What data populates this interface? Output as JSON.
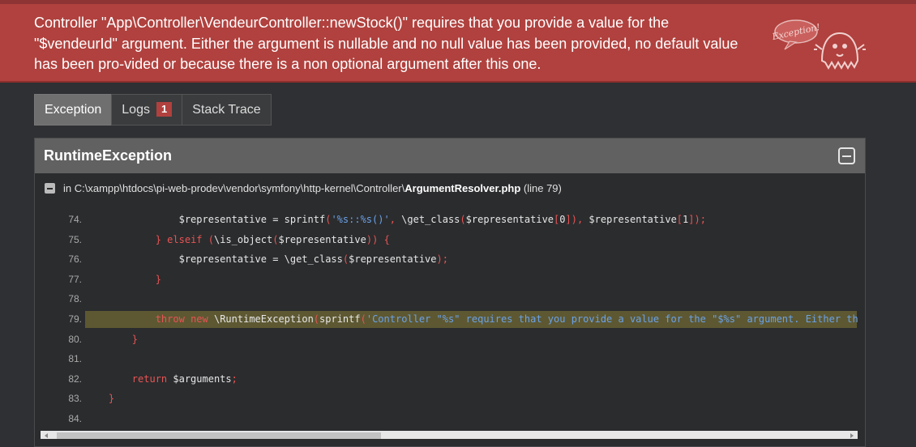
{
  "header": {
    "message": "Controller \"App\\Controller\\VendeurController::newStock()\" requires that you provide a value for the \"$vendeurId\" argument. Either the argument is nullable and no null value has been provided, no default value has been pro-vided or because there is a non optional argument after this one.",
    "ghost_label": "Exception!"
  },
  "tabs": [
    {
      "label": "Exception",
      "active": true
    },
    {
      "label": "Logs",
      "badge": "1"
    },
    {
      "label": "Stack Trace"
    }
  ],
  "exception": {
    "class_name": "RuntimeException",
    "file_prefix": "in C:\\xampp\\htdocs\\pi-web-prodev\\vendor\\symfony\\http-kernel\\Controller\\",
    "file_name": "ArgumentResolver.php",
    "file_suffix": " (line 79)"
  },
  "code_lines": [
    {
      "num": "74.",
      "indent": "                ",
      "code": "$representative = sprintf('%s::%s()', \\get_class($representative[0]), $representative[1]);"
    },
    {
      "num": "75.",
      "indent": "            ",
      "code": "} elseif (\\is_object($representative)) {"
    },
    {
      "num": "76.",
      "indent": "                ",
      "code": "$representative = \\get_class($representative);"
    },
    {
      "num": "77.",
      "indent": "            ",
      "code": "}"
    },
    {
      "num": "78.",
      "indent": "",
      "code": ""
    },
    {
      "num": "79.",
      "indent": "            ",
      "code": "throw new \\RuntimeException(sprintf('Controller \"%s\" requires that you provide a value for the \"$%s\" argument. Either th",
      "highlight": true
    },
    {
      "num": "80.",
      "indent": "        ",
      "code": "}"
    },
    {
      "num": "81.",
      "indent": "",
      "code": ""
    },
    {
      "num": "82.",
      "indent": "        ",
      "code": "return $arguments;"
    },
    {
      "num": "83.",
      "indent": "    ",
      "code": "}"
    },
    {
      "num": "84.",
      "indent": "",
      "code": ""
    }
  ],
  "colors": {
    "header_bg": "#b0413e",
    "highlight_line": "#5d5832",
    "keyword": "#e95454",
    "string": "#6aa2e8"
  }
}
